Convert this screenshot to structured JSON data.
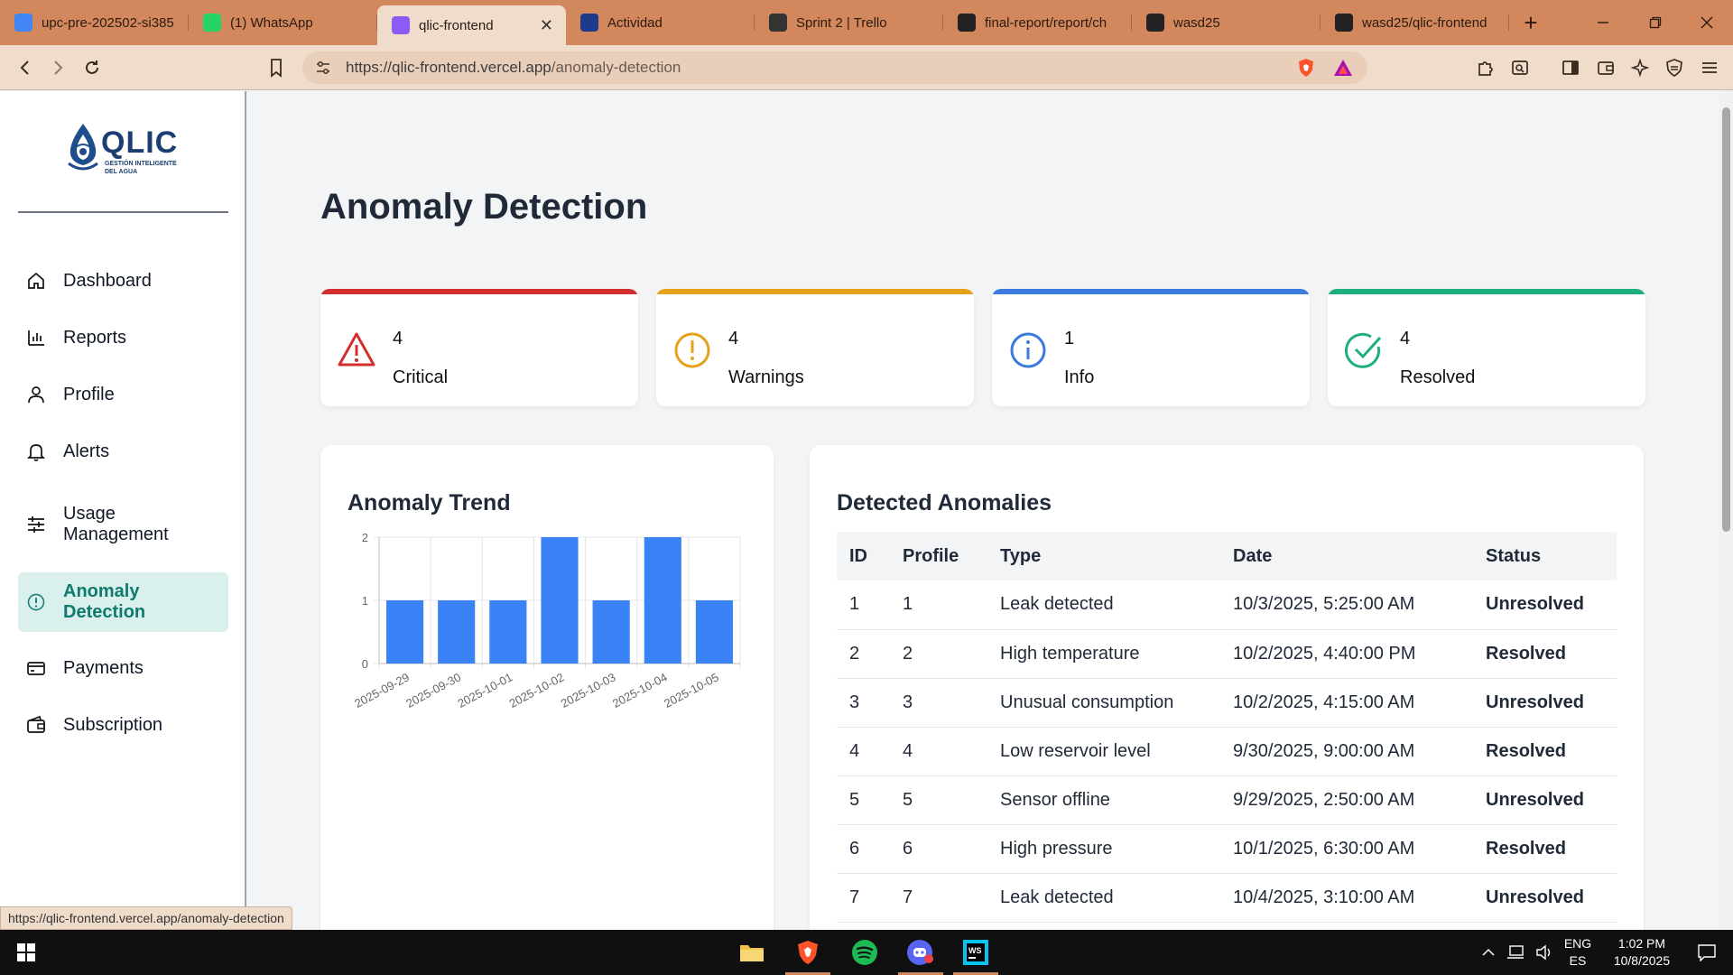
{
  "browser": {
    "tabs": [
      {
        "title": "upc-pre-202502-si385",
        "icon": "docs-icon",
        "color": "#4285f4",
        "active": false
      },
      {
        "title": "(1) WhatsApp",
        "icon": "whatsapp-icon",
        "color": "#25d366",
        "active": false
      },
      {
        "title": "qlic-frontend",
        "icon": "vercel-vite-icon",
        "color": "#8b5cf6",
        "active": true
      },
      {
        "title": "Actividad",
        "icon": "app-icon",
        "color": "#1e3a8a",
        "active": false
      },
      {
        "title": "Sprint 2 | Trello",
        "icon": "trello-icon",
        "color": "#333333",
        "active": false
      },
      {
        "title": "final-report/report/ch",
        "icon": "github-icon",
        "color": "#222222",
        "active": false
      },
      {
        "title": "wasd25",
        "icon": "github-icon",
        "color": "#222222",
        "active": false
      },
      {
        "title": "wasd25/qlic-frontend",
        "icon": "github-icon",
        "color": "#222222",
        "active": false
      }
    ],
    "url_host": "https://qlic-frontend.vercel.app",
    "url_path": "/anomaly-detection",
    "status_url": "https://qlic-frontend.vercel.app/anomaly-detection"
  },
  "sidebar": {
    "brand": "QLIC",
    "tagline_1": "GESTIÓN INTELIGENTE",
    "tagline_2": "DEL AGUA",
    "items": [
      {
        "label": "Dashboard",
        "icon": "home-icon"
      },
      {
        "label": "Reports",
        "icon": "bar-chart-icon"
      },
      {
        "label": "Profile",
        "icon": "user-icon"
      },
      {
        "label": "Alerts",
        "icon": "bell-icon"
      },
      {
        "label": "Usage Management",
        "icon": "sliders-icon"
      },
      {
        "label": "Anomaly Detection",
        "icon": "alert-circle-icon",
        "active": true
      },
      {
        "label": "Payments",
        "icon": "credit-card-icon"
      },
      {
        "label": "Subscription",
        "icon": "wallet-icon"
      }
    ]
  },
  "main": {
    "title": "Anomaly Detection",
    "stats": [
      {
        "value": "4",
        "label": "Critical",
        "color": "#d32f2f",
        "icon": "warning-triangle-icon"
      },
      {
        "value": "4",
        "label": "Warnings",
        "color": "#e6a11a",
        "icon": "exclamation-circle-icon"
      },
      {
        "value": "1",
        "label": "Info",
        "color": "#3b7be0",
        "icon": "info-circle-icon"
      },
      {
        "value": "4",
        "label": "Resolved",
        "color": "#1fae80",
        "icon": "check-circle-icon"
      }
    ],
    "trend_title": "Anomaly Trend",
    "anomalies_title": "Detected Anomalies",
    "table": {
      "headers": [
        "ID",
        "Profile",
        "Type",
        "Date",
        "Status"
      ],
      "rows": [
        {
          "id": "1",
          "profile": "1",
          "type": "Leak detected",
          "date": "10/3/2025, 5:25:00 AM",
          "status": "Unresolved"
        },
        {
          "id": "2",
          "profile": "2",
          "type": "High temperature",
          "date": "10/2/2025, 4:40:00 PM",
          "status": "Resolved"
        },
        {
          "id": "3",
          "profile": "3",
          "type": "Unusual consumption",
          "date": "10/2/2025, 4:15:00 AM",
          "status": "Unresolved"
        },
        {
          "id": "4",
          "profile": "4",
          "type": "Low reservoir level",
          "date": "9/30/2025, 9:00:00 AM",
          "status": "Resolved"
        },
        {
          "id": "5",
          "profile": "5",
          "type": "Sensor offline",
          "date": "9/29/2025, 2:50:00 AM",
          "status": "Unresolved"
        },
        {
          "id": "6",
          "profile": "6",
          "type": "High pressure",
          "date": "10/1/2025, 6:30:00 AM",
          "status": "Resolved"
        },
        {
          "id": "7",
          "profile": "7",
          "type": "Leak detected",
          "date": "10/4/2025, 3:10:00 AM",
          "status": "Unresolved"
        }
      ]
    }
  },
  "chart_data": {
    "type": "bar",
    "title": "Anomaly Trend",
    "categories": [
      "2025-09-29",
      "2025-09-30",
      "2025-10-01",
      "2025-10-02",
      "2025-10-03",
      "2025-10-04",
      "2025-10-05"
    ],
    "values": [
      1,
      1,
      1,
      2,
      1,
      2,
      1
    ],
    "yticks": [
      "0",
      "1",
      "2"
    ],
    "ylim": [
      0,
      2
    ],
    "grid": true,
    "bar_color": "#3b82f6",
    "xlabel": "",
    "ylabel": ""
  },
  "taskbar": {
    "lang_1": "ENG",
    "lang_2": "ES",
    "time": "1:02 PM",
    "date": "10/8/2025"
  }
}
